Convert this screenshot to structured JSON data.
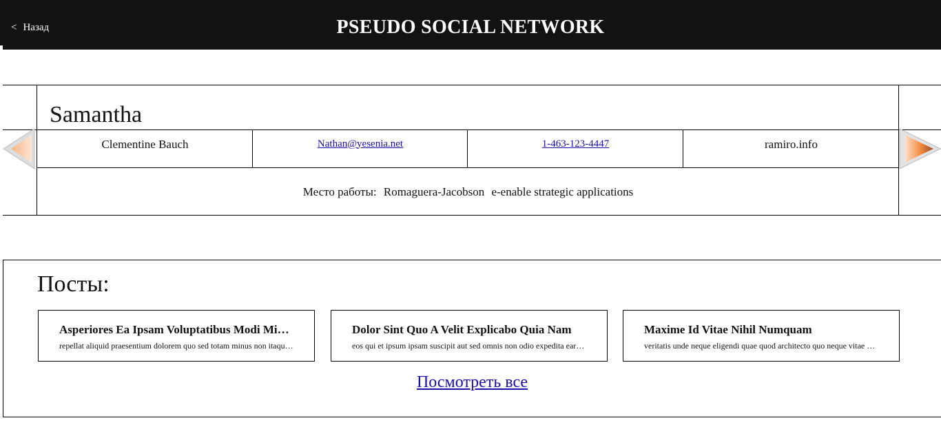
{
  "header": {
    "back_chevron": "<",
    "back_label": "Назад",
    "title": "PSEUDO SOCIAL NETWORK"
  },
  "profile": {
    "username": "Samantha",
    "name": "Clementine Bauch",
    "email": "Nathan@yesenia.net",
    "phone": "1-463-123-4447",
    "website": "ramiro.info",
    "work_label": "Место работы:",
    "company": "Romaguera-Jacobson",
    "catch_phrase": "e-enable strategic applications",
    "arrow_left_icon": "arrow-left-icon",
    "arrow_right_icon": "arrow-right-icon"
  },
  "posts": {
    "heading": "Посты:",
    "items": [
      {
        "title": "Asperiores Ea Ipsam Voluptatibus Modi Minima Quia Sint",
        "body": "repellat aliquid praesentium dolorem quo sed totam minus non itaque nihil labore molestiae sunt dolor eveniet hic recusandae veniam"
      },
      {
        "title": "Dolor Sint Quo A Velit Explicabo Quia Nam",
        "body": "eos qui et ipsum ipsam suscipit aut sed omnis non odio expedita earum mollitia molestiae aut atque rem suscipit"
      },
      {
        "title": "Maxime Id Vitae Nihil Numquam",
        "body": "veritatis unde neque eligendi quae quod architecto quo neque vitae est illo sit tempora doloremque fugit quod"
      }
    ],
    "see_all": "Посмотреть все"
  },
  "colors": {
    "header_bg": "#121212",
    "link": "#1a0dab",
    "arrow_orange": "#f08a3c"
  }
}
